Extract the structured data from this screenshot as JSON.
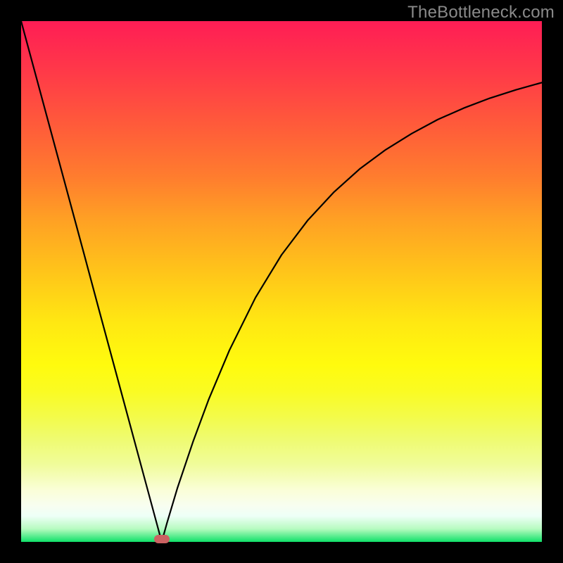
{
  "watermark": {
    "text": "TheBottleneck.com"
  },
  "chart_data": {
    "type": "line",
    "title": "",
    "xlabel": "",
    "ylabel": "",
    "xlim": [
      0,
      100
    ],
    "ylim": [
      0,
      100
    ],
    "grid": false,
    "legend": false,
    "background_gradient": {
      "top_color": "#ff1d55",
      "mid_color": "#ffe812",
      "bottom_color": "#10e169"
    },
    "optimum_x": 27,
    "curve_points": [
      {
        "x": 0.0,
        "y": 100.0
      },
      {
        "x": 3.0,
        "y": 88.9
      },
      {
        "x": 6.0,
        "y": 77.8
      },
      {
        "x": 9.0,
        "y": 66.7
      },
      {
        "x": 12.0,
        "y": 55.6
      },
      {
        "x": 15.0,
        "y": 44.4
      },
      {
        "x": 18.0,
        "y": 33.3
      },
      {
        "x": 21.0,
        "y": 22.2
      },
      {
        "x": 24.0,
        "y": 11.1
      },
      {
        "x": 26.0,
        "y": 3.7
      },
      {
        "x": 27.0,
        "y": 0.0
      },
      {
        "x": 28.0,
        "y": 3.6
      },
      {
        "x": 30.0,
        "y": 10.3
      },
      {
        "x": 33.0,
        "y": 19.2
      },
      {
        "x": 36.0,
        "y": 27.3
      },
      {
        "x": 40.0,
        "y": 36.8
      },
      {
        "x": 45.0,
        "y": 46.9
      },
      {
        "x": 50.0,
        "y": 55.1
      },
      {
        "x": 55.0,
        "y": 61.7
      },
      {
        "x": 60.0,
        "y": 67.1
      },
      {
        "x": 65.0,
        "y": 71.6
      },
      {
        "x": 70.0,
        "y": 75.3
      },
      {
        "x": 75.0,
        "y": 78.4
      },
      {
        "x": 80.0,
        "y": 81.1
      },
      {
        "x": 85.0,
        "y": 83.3
      },
      {
        "x": 90.0,
        "y": 85.2
      },
      {
        "x": 95.0,
        "y": 86.8
      },
      {
        "x": 100.0,
        "y": 88.2
      }
    ],
    "marker": {
      "x": 27,
      "y": 0,
      "color": "#cb6262"
    }
  }
}
